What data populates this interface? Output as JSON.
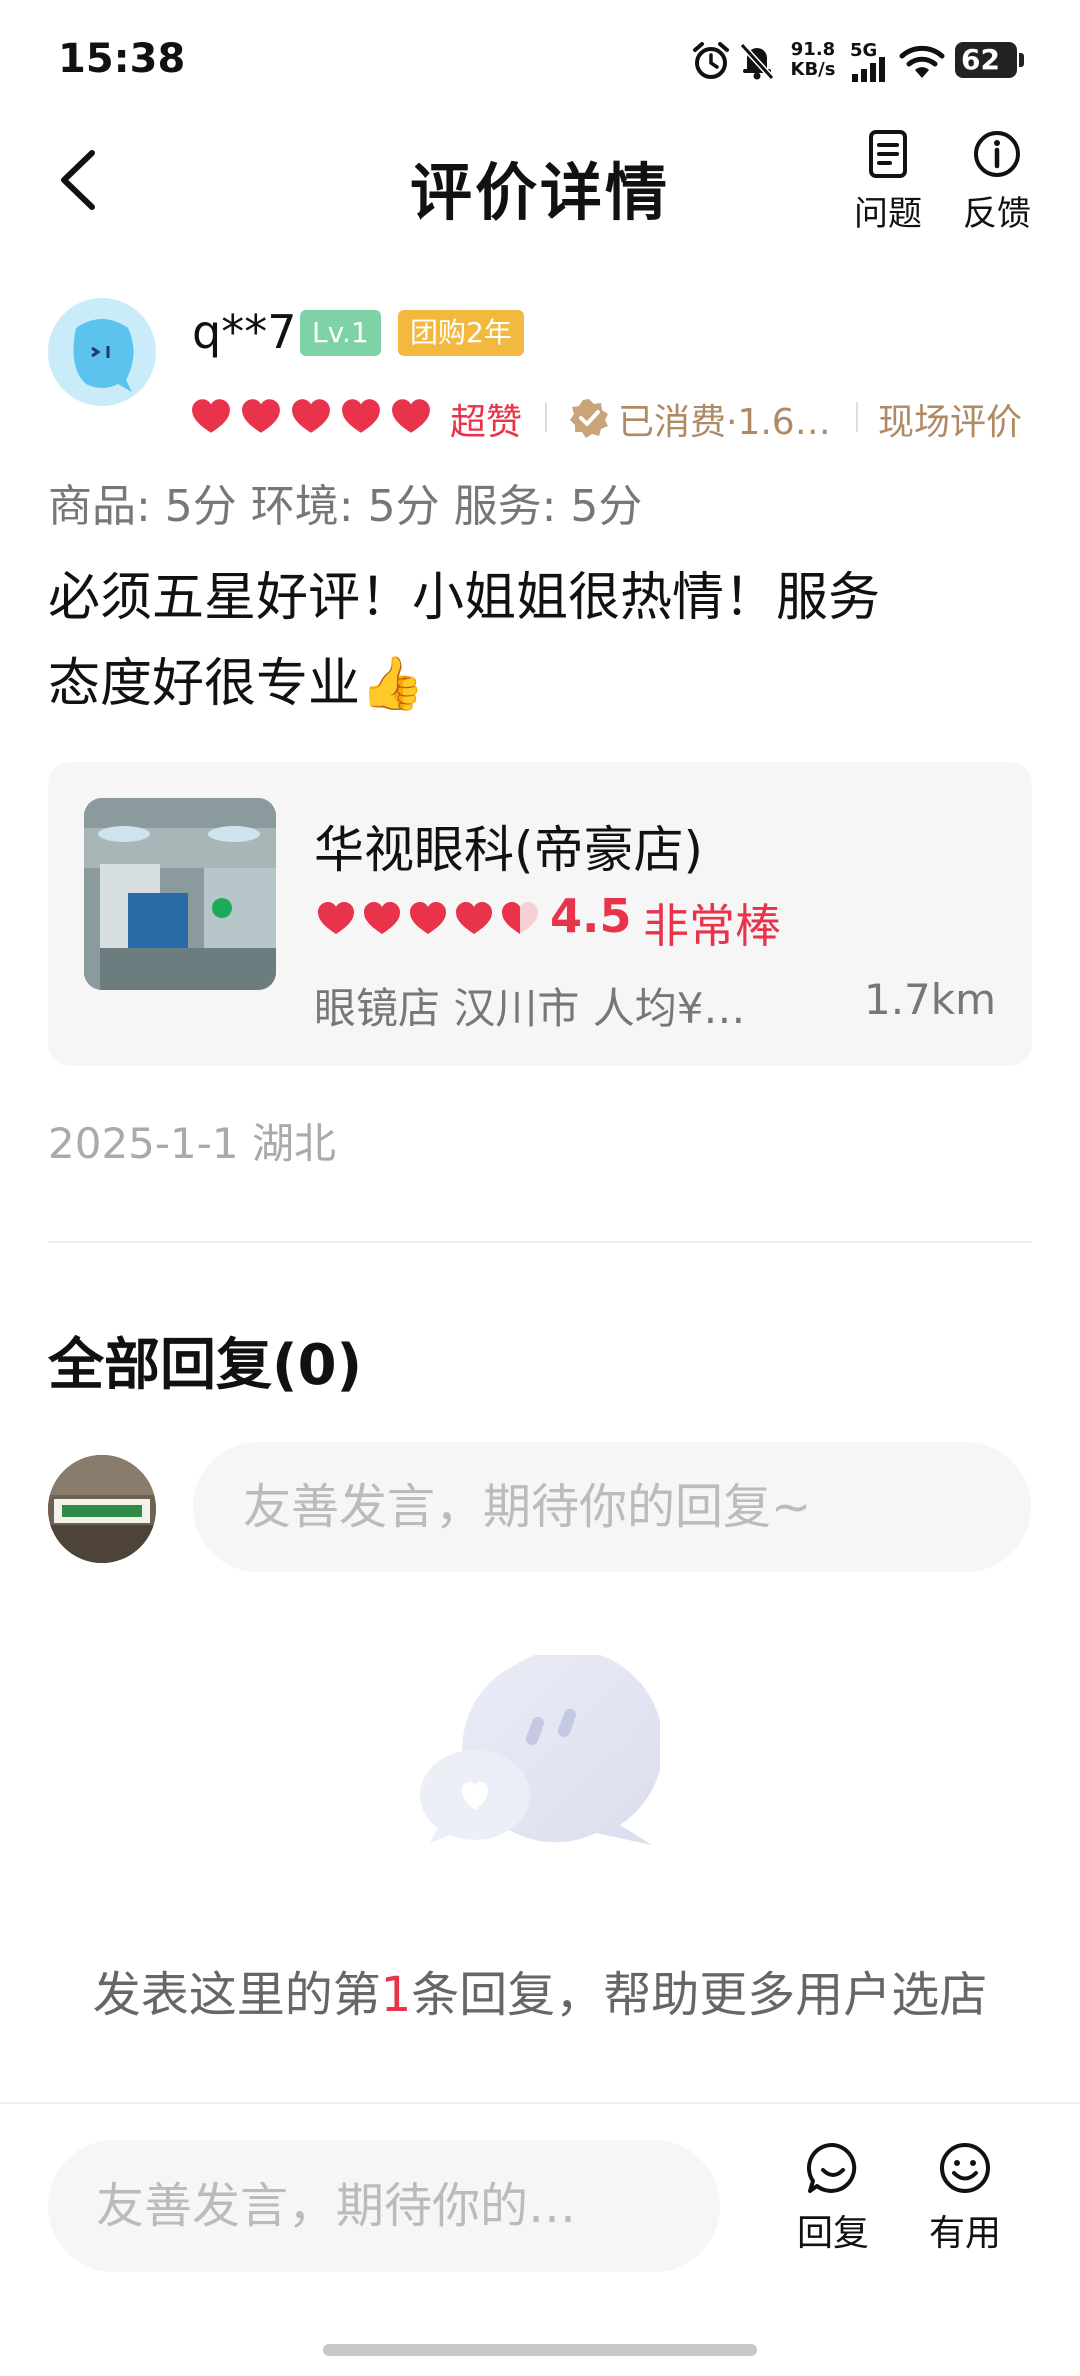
{
  "status_bar": {
    "time": "15:38",
    "net_speed_value": "91.8",
    "net_speed_unit": "KB/s",
    "network": "5G",
    "battery": "62",
    "icons": [
      "alarm-icon",
      "mute-icon",
      "signal-icon",
      "wifi-icon",
      "battery-icon"
    ]
  },
  "header": {
    "title": "评价详情",
    "actions": [
      {
        "label": "问题",
        "icon": "document-icon"
      },
      {
        "label": "反馈",
        "icon": "info-icon"
      }
    ]
  },
  "review": {
    "username": "q**7",
    "level": "Lv.1",
    "group_badge": "团购2年",
    "hearts": 5,
    "rating_label": "超赞",
    "consumed": "已消费·1.6…",
    "onsite": "现场评价",
    "subscores": "商品: 5分 环境: 5分 服务: 5分",
    "text_line1": "必须五星好评！小姐姐很热情！服务",
    "text_line2": "态度好很专业👍",
    "date_location": "2025-1-1 湖北"
  },
  "shop": {
    "name": "华视眼科(帝豪店)",
    "score": "4.5",
    "score_fraction": 0.9,
    "score_label": "非常棒",
    "meta": "眼镜店  汉川市  人均¥…",
    "distance": "1.7km"
  },
  "replies": {
    "title": "全部回复(0)",
    "input_placeholder": "友善发言，期待你的回复~",
    "empty_prefix": "发表这里的第",
    "empty_number": "1",
    "empty_suffix": "条回复，帮助更多用户选店"
  },
  "bottom_bar": {
    "input_placeholder": "友善发言，期待你的…",
    "reply_label": "回复",
    "useful_label": "有用"
  },
  "colors": {
    "accent_red": "#e8334a",
    "gold": "#b08a64",
    "level_green": "#7fd2a5",
    "badge_orange": "#f3b93f"
  }
}
